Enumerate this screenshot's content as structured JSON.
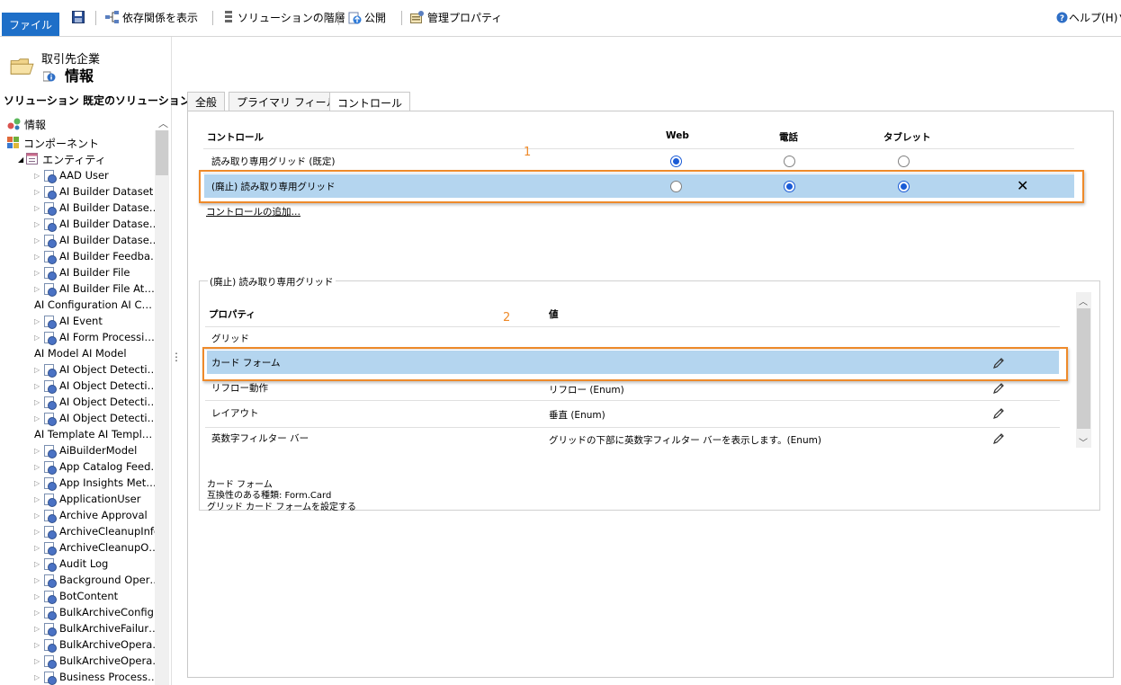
{
  "toolbar": {
    "file": "ファイル",
    "dependencies": "依存関係を表示",
    "hierarchy": "ソリューションの階層",
    "publish": "公開",
    "managed_properties": "管理プロパティ",
    "help": "ヘルプ(H)",
    "help_arrow": "▾"
  },
  "left": {
    "entity_subtitle": "取引先企業",
    "entity_title": "情報",
    "solution_label": "ソリューション 既定のソリューション",
    "nav_info": "情報",
    "nav_components": "コンポーネント",
    "nav_entities": "エンティティ",
    "entities": [
      "AAD User",
      "AI Builder Dataset",
      "AI Builder Datase…",
      "AI Builder Datase…",
      "AI Builder Datase…",
      "AI Builder Feedba…",
      "AI Builder File",
      "AI Builder File At…",
      "AI Configuration AI C…",
      "AI Event",
      "AI Form Processi…",
      "AI Model AI Model",
      "AI Object Detecti…",
      "AI Object Detecti…",
      "AI Object Detecti…",
      "AI Object Detecti…",
      "AI Template AI Templ…",
      "AiBuilderModel",
      "App Catalog Feed…",
      "App Insights Met…",
      "ApplicationUser",
      "Archive Approval",
      "ArchiveCleanupInfo",
      "ArchiveCleanupO…",
      "Audit Log",
      "Background Oper…",
      "BotContent",
      "BulkArchiveConfig",
      "BulkArchiveFailur…",
      "BulkArchiveOpera…",
      "BulkArchiveOpera…",
      "Business Process…"
    ]
  },
  "tabs": [
    "全般",
    "プライマリ フィールド",
    "コントロール"
  ],
  "controls": {
    "headers": {
      "control": "コントロール",
      "web": "Web",
      "phone": "電話",
      "tablet": "タブレット"
    },
    "rows": [
      {
        "name": "読み取り専用グリッド (既定)",
        "web": true,
        "phone": false,
        "tablet": false
      },
      {
        "name": "(廃止) 読み取り専用グリッド",
        "web": false,
        "phone": true,
        "tablet": true
      }
    ],
    "add_link": "コントロールの追加…",
    "callout1": "1",
    "remove_icon": "✕"
  },
  "properties": {
    "group_title": "(廃止) 読み取り専用グリッド",
    "headers": {
      "property": "プロパティ",
      "value": "値"
    },
    "rows": [
      {
        "name": "グリッド",
        "value": ""
      },
      {
        "name": "カード フォーム",
        "value": ""
      },
      {
        "name": "リフロー動作",
        "value": "リフロー (Enum)"
      },
      {
        "name": "レイアウト",
        "value": "垂直 (Enum)"
      },
      {
        "name": "英数字フィルター バー",
        "value": "グリッドの下部に英数字フィルター バーを表示します。(Enum)"
      }
    ],
    "callout2": "2",
    "description": {
      "line1": "カード フォーム",
      "line2": "互換性のある種類: Form.Card",
      "line3": "グリッド カード フォームを設定する"
    }
  },
  "colors": {
    "accent": "#1e6fc8",
    "selection": "#b4d5ef",
    "callout": "#ee8a2a"
  }
}
